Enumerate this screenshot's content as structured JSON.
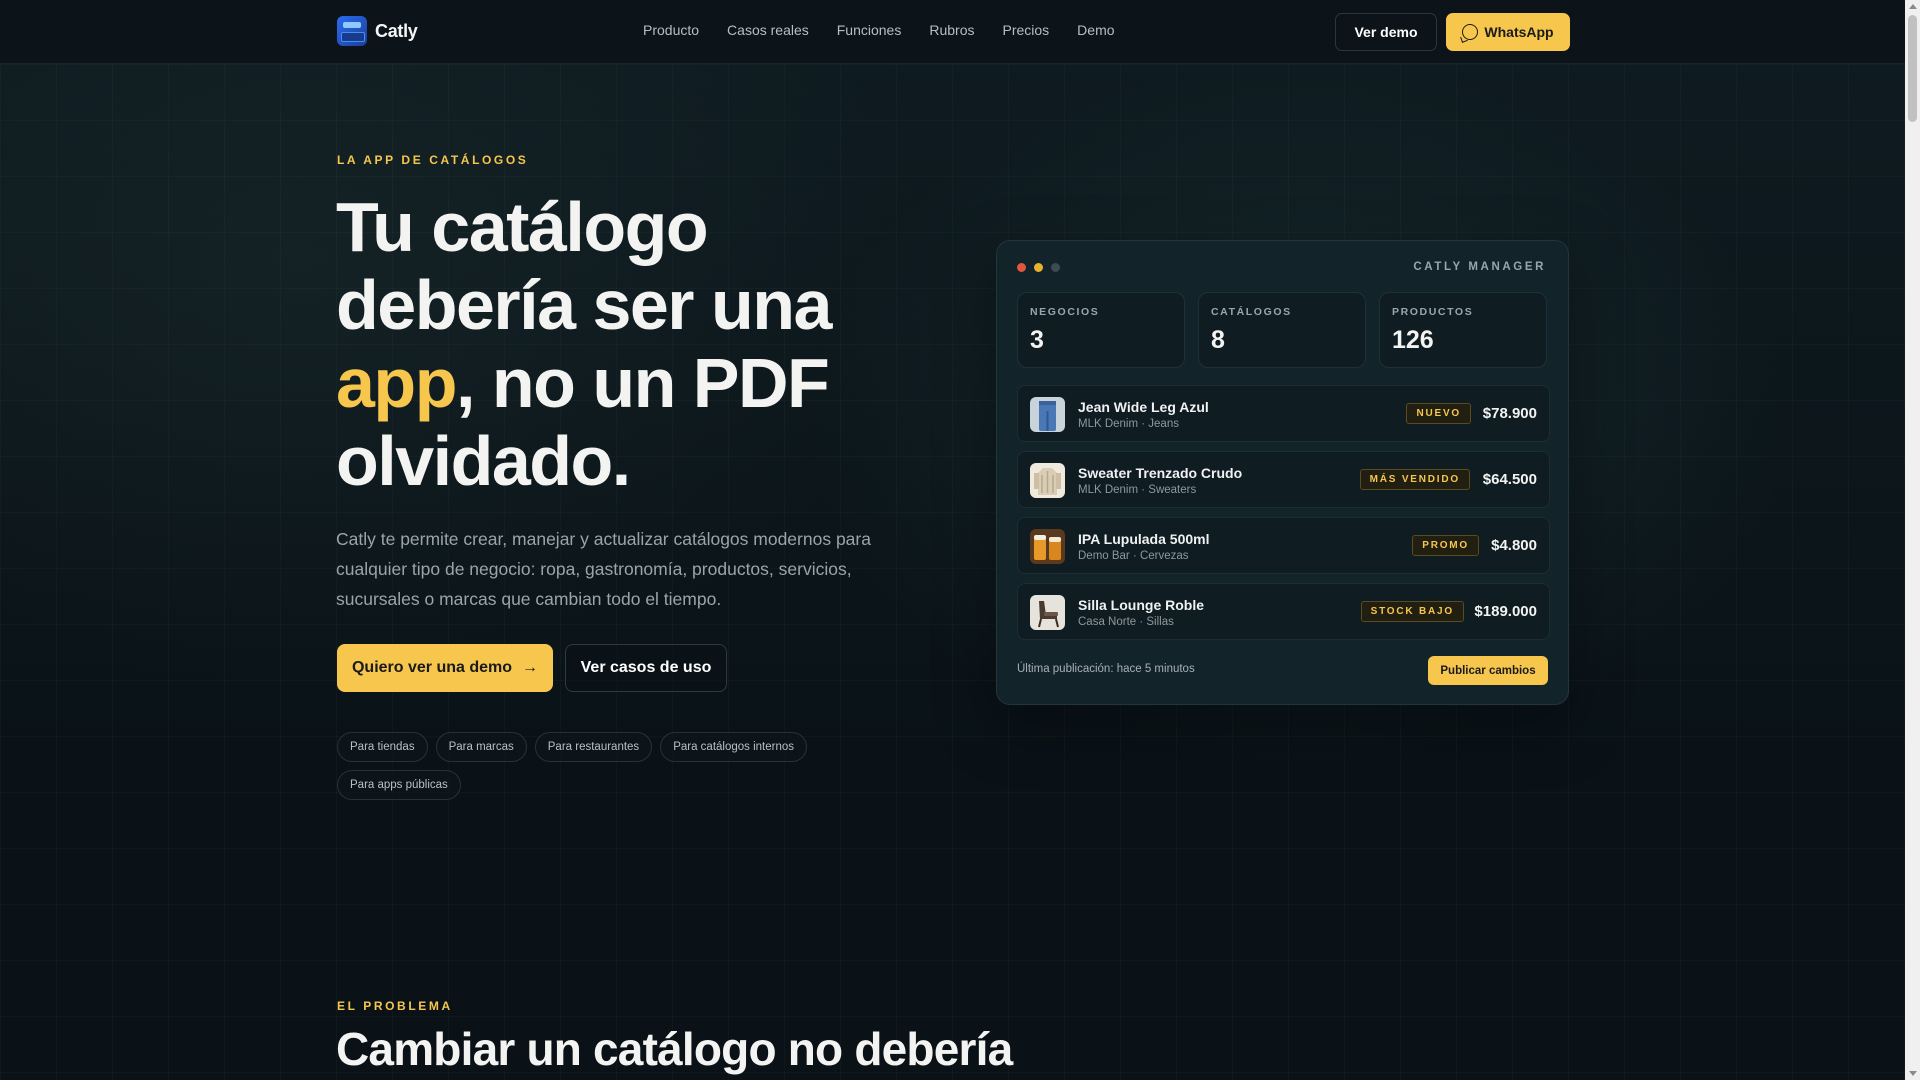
{
  "header": {
    "logo": "Catly",
    "nav": [
      "Producto",
      "Casos reales",
      "Funciones",
      "Rubros",
      "Precios",
      "Demo"
    ],
    "demo_button": "Ver demo",
    "whatsapp_button": "WhatsApp"
  },
  "hero": {
    "eyebrow": "LA APP DE CATÁLOGOS",
    "title_part1": "Tu catálogo debería ser una ",
    "title_accent": "app",
    "title_part2": ", no un PDF olvidado.",
    "description": "Catly te permite crear, manejar y actualizar catálogos modernos para cualquier tipo de negocio: ropa, gastronomía, productos, servicios, sucursales o marcas que cambian todo el tiempo.",
    "primary_cta": "Quiero ver una demo",
    "primary_cta_arrow": "→",
    "secondary_cta": "Ver casos de uso",
    "chips": [
      "Para tiendas",
      "Para marcas",
      "Para restaurantes",
      "Para catálogos internos",
      "Para apps públicas"
    ]
  },
  "manager": {
    "title": "CATLY MANAGER",
    "dot_colors": [
      "#e2553f",
      "#e6b22f",
      "#3f4b52"
    ],
    "stats": [
      {
        "label": "NEGOCIOS",
        "value": "3"
      },
      {
        "label": "CATÁLOGOS",
        "value": "8"
      },
      {
        "label": "PRODUCTOS",
        "value": "126"
      }
    ],
    "items": [
      {
        "name": "Jean Wide Leg Azul",
        "sub": "MLK Denim · Jeans",
        "badge": "NUEVO",
        "price": "$78.900",
        "thumb": "jeans-thumbnail"
      },
      {
        "name": "Sweater Trenzado Crudo",
        "sub": "MLK Denim · Sweaters",
        "badge": "MÁS VENDIDO",
        "price": "$64.500",
        "thumb": "sweater-thumbnail"
      },
      {
        "name": "IPA Lupulada 500ml",
        "sub": "Demo Bar · Cervezas",
        "badge": "PROMO",
        "price": "$4.800",
        "thumb": "beer-thumbnail"
      },
      {
        "name": "Silla Lounge Roble",
        "sub": "Casa Norte · Sillas",
        "badge": "STOCK BAJO",
        "price": "$189.000",
        "thumb": "chair-thumbnail"
      }
    ],
    "footer": "Última publicación: hace 5 minutos",
    "publish_button": "Publicar cambios"
  },
  "section2": {
    "eyebrow": "EL PROBLEMA",
    "title": "Cambiar un catálogo no debería"
  },
  "colors": {
    "accent": "#f6c64d",
    "background": "#0a1217",
    "card": "#13232a"
  }
}
